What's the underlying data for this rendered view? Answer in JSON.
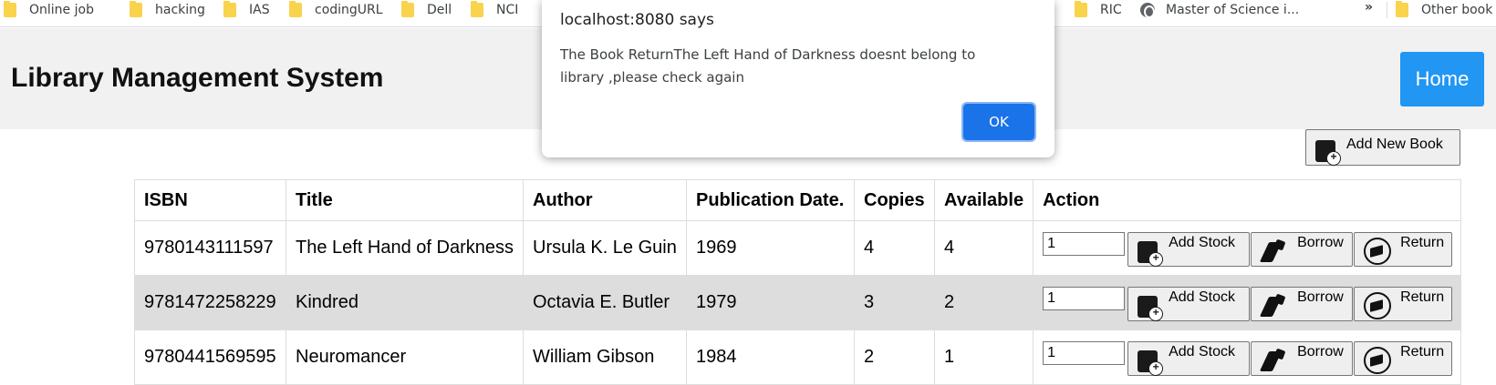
{
  "bookmarks": [
    {
      "label": "Online job",
      "icon": "folder-icon"
    },
    {
      "label": "hacking",
      "icon": "folder-icon"
    },
    {
      "label": "IAS",
      "icon": "folder-icon"
    },
    {
      "label": "codingURL",
      "icon": "folder-icon"
    },
    {
      "label": "Dell",
      "icon": "folder-icon"
    },
    {
      "label": "NCI",
      "icon": "folder-icon"
    },
    {
      "label": "RIC",
      "icon": "folder-icon"
    },
    {
      "label": "Master of Science i...",
      "icon": "globe-icon"
    },
    {
      "label": "Other book",
      "icon": "folder-icon"
    }
  ],
  "bookmarks_overflow": "»",
  "header": {
    "title": "Library Management System",
    "home_label": "Home",
    "accent": "#2196f3"
  },
  "toolbar": {
    "add_new_book_label": "Add New Book"
  },
  "table": {
    "columns": [
      "ISBN",
      "Title",
      "Author",
      "Publication Date.",
      "Copies",
      "Available",
      "Action"
    ],
    "rows": [
      {
        "isbn": "9780143111597",
        "title": "The Left Hand of Darkness",
        "author": "Ursula K. Le Guin",
        "date": "1969",
        "copies": "4",
        "available": "4",
        "qty": "1"
      },
      {
        "isbn": "9781472258229",
        "title": "Kindred",
        "author": "Octavia E. Butler",
        "date": "1979",
        "copies": "3",
        "available": "2",
        "qty": "1"
      },
      {
        "isbn": "9780441569595",
        "title": "Neuromancer",
        "author": "William Gibson",
        "date": "1984",
        "copies": "2",
        "available": "1",
        "qty": "1"
      }
    ],
    "actions": {
      "add_stock": "Add Stock",
      "borrow": "Borrow",
      "return": "Return"
    }
  },
  "dialog": {
    "title": "localhost:8080 says",
    "message": "The Book ReturnThe Left Hand of Darkness doesnt belong to library ,please check again",
    "ok_label": "OK",
    "ok_color": "#1a73e8"
  }
}
